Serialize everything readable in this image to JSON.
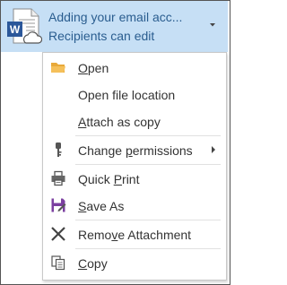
{
  "attachment": {
    "title": "Adding your email acc...",
    "subtitle": "Recipients can edit",
    "icon": "word-doc-cloud-icon"
  },
  "menu": {
    "items": [
      {
        "label": "Open",
        "mnemonic": "O",
        "icon": "folder-icon"
      },
      {
        "label": "Open file location",
        "mnemonic": "",
        "icon": ""
      },
      {
        "label": "Attach as copy",
        "mnemonic": "A",
        "icon": ""
      },
      {
        "label": "Change permissions",
        "mnemonic": "p",
        "icon": "key-icon",
        "submenu": true
      },
      {
        "label": "Quick Print",
        "mnemonic": "P",
        "icon": "printer-icon"
      },
      {
        "label": "Save As",
        "mnemonic": "S",
        "icon": "save-as-icon"
      },
      {
        "label": "Remove Attachment",
        "mnemonic": "v",
        "icon": "remove-x-icon"
      },
      {
        "label": "Copy",
        "mnemonic": "C",
        "icon": "copy-icon"
      }
    ]
  },
  "colors": {
    "header_bg": "#c6dff5",
    "header_text": "#2a5d8f",
    "word_blue": "#2b579a",
    "folder": "#f5c05a",
    "save_purple": "#7b3fa0"
  }
}
